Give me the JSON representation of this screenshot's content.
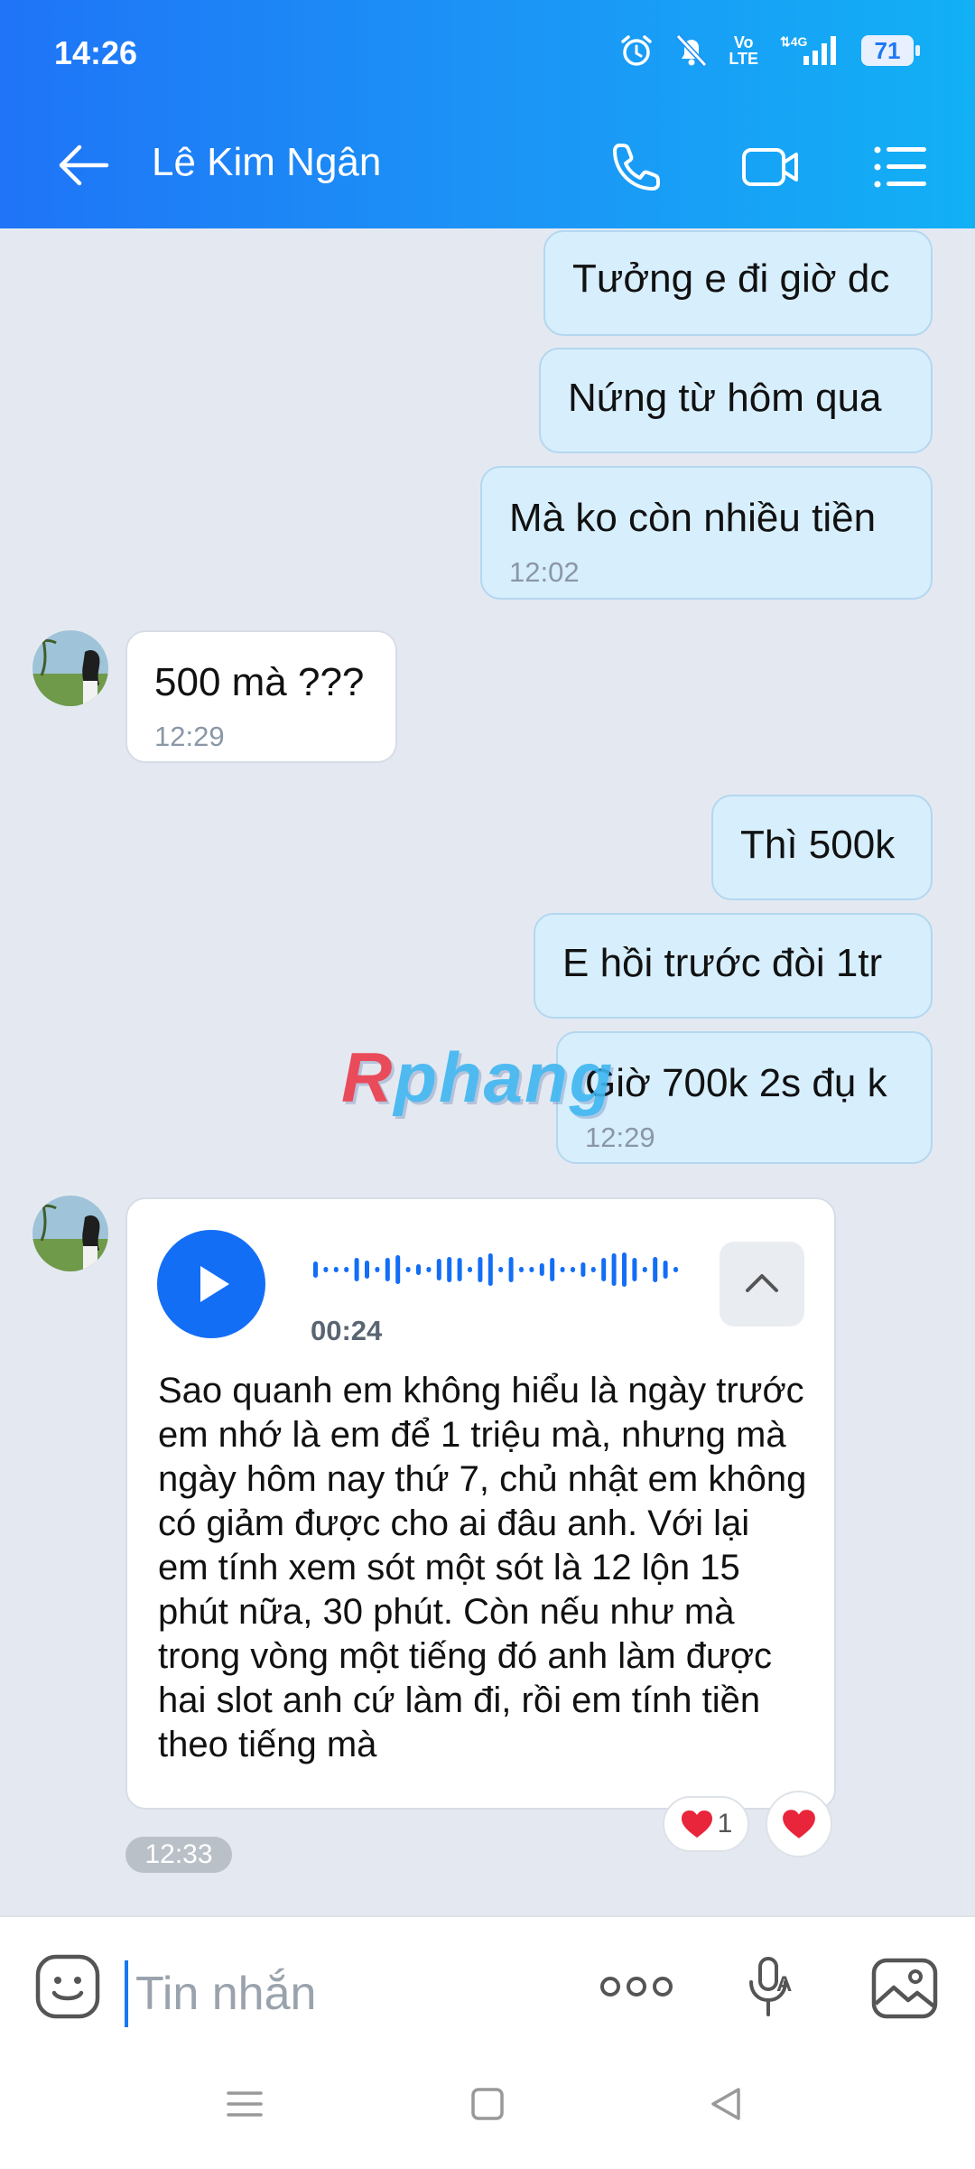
{
  "status_bar": {
    "time": "14:26",
    "volte_label": "Vo\nLTE",
    "network_label": "4G",
    "battery": "71"
  },
  "header": {
    "contact_name": "Lê Kim Ngân",
    "back_icon": "arrow-left-icon",
    "call_icon": "phone-icon",
    "video_icon": "video-camera-icon",
    "menu_icon": "list-menu-icon"
  },
  "messages": [
    {
      "direction": "outgoing",
      "text": "Tưởng e đi giờ dc",
      "time": ""
    },
    {
      "direction": "outgoing",
      "text": "Nứng từ hôm qua",
      "time": ""
    },
    {
      "direction": "outgoing",
      "text": "Mà ko còn nhiều tiền",
      "time": "12:02"
    },
    {
      "direction": "incoming",
      "text": "500 mà ???",
      "time": "12:29"
    },
    {
      "direction": "outgoing",
      "text": "Thì 500k",
      "time": ""
    },
    {
      "direction": "outgoing",
      "text": "E hồi trước đòi 1tr",
      "time": ""
    },
    {
      "direction": "outgoing",
      "text": "Giờ 700k 2s đụ k",
      "time": "12:29"
    }
  ],
  "voice_message": {
    "duration": "00:24",
    "transcript": "Sao quanh em không hiểu là ngày trước em nhớ là em để 1 triệu mà, nhưng mà ngày hôm nay thứ 7, chủ nhật em không có giảm được cho ai đâu anh. Với lại em tính xem sót một sót là 12 lộn 15 phút nữa, 30 phút. Còn nếu như mà trong vòng một tiếng đó anh làm được hai slot anh cứ làm đi, rồi em tính tiền theo tiếng mà",
    "reaction_count": "1",
    "time": "12:33"
  },
  "watermark": {
    "first": "R",
    "rest": "phang"
  },
  "composer": {
    "placeholder": "Tin nhắn",
    "value": ""
  },
  "colors": {
    "header_start": "#1f74f7",
    "header_end": "#12b0f5",
    "outgoing_bubble": "#d7eefd",
    "incoming_bubble": "#ffffff",
    "accent": "#136ef6",
    "reaction_heart": "#e8253a"
  }
}
